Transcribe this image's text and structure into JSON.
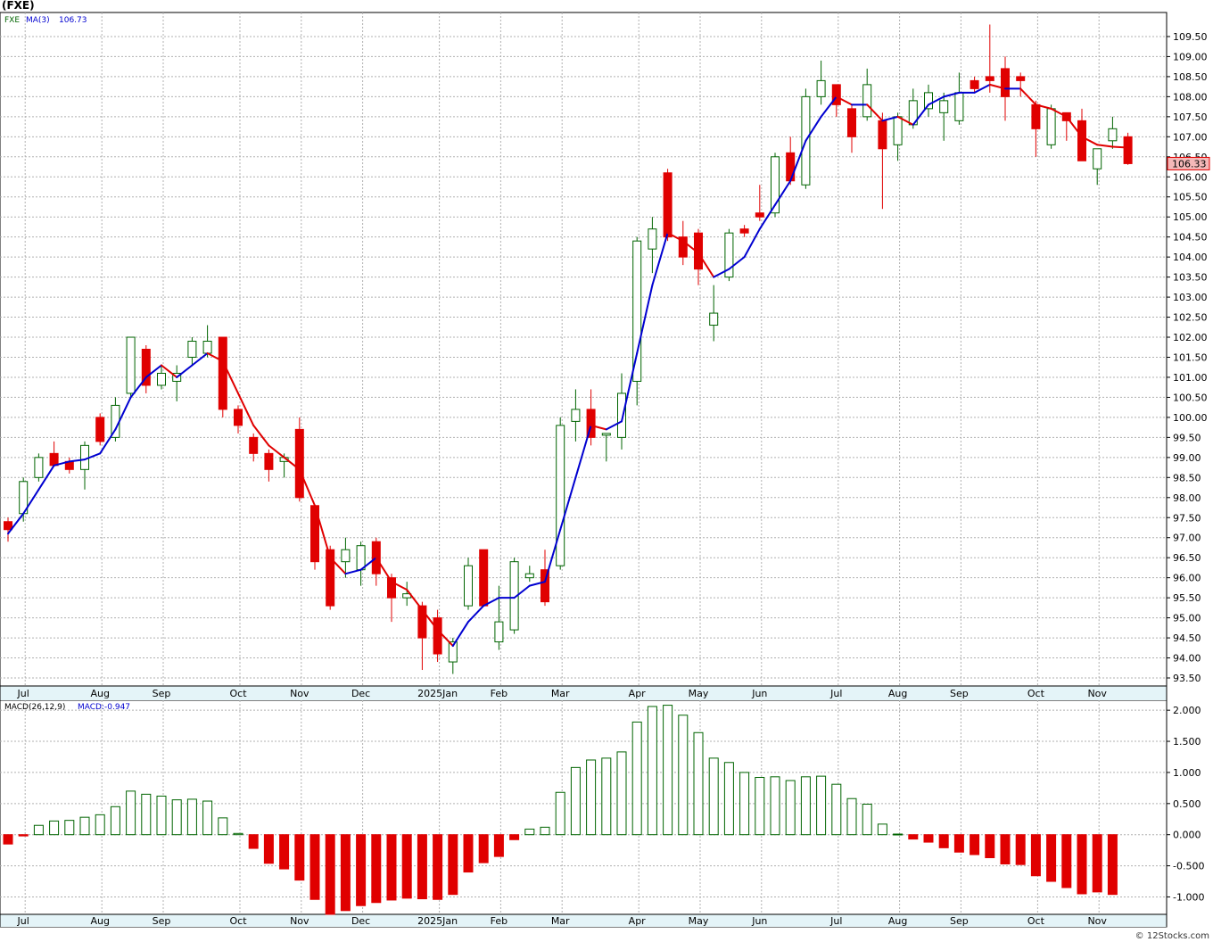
{
  "title": "(FXE)",
  "footer": "© 12Stocks.com",
  "colors": {
    "up": "#006400",
    "down": "#e00000",
    "ma_up": "#0000d0",
    "ma_down": "#e00000",
    "grid": "#b0b0b0",
    "label_red_bg": "#f4b8b8"
  },
  "chart_data": [
    {
      "type": "candlestick",
      "legend": {
        "ticker": "FXE",
        "ma_label": "MA(3)",
        "ma_value": "106.73"
      },
      "last_price_label": "106.33",
      "ylim": [
        93.3,
        110.1
      ],
      "y_ticks": [
        "93.50",
        "94.00",
        "94.50",
        "95.00",
        "95.50",
        "96.00",
        "96.50",
        "97.00",
        "97.50",
        "98.00",
        "98.50",
        "99.00",
        "99.50",
        "100.00",
        "100.50",
        "101.00",
        "101.50",
        "102.00",
        "102.50",
        "103.00",
        "103.50",
        "104.00",
        "104.50",
        "105.00",
        "105.50",
        "106.00",
        "106.50",
        "107.00",
        "107.50",
        "108.00",
        "108.50",
        "109.00",
        "109.50"
      ],
      "x_labels": [
        {
          "label": "Jul",
          "index": 1
        },
        {
          "label": "Aug",
          "index": 6
        },
        {
          "label": "Sep",
          "index": 10
        },
        {
          "label": "Oct",
          "index": 15
        },
        {
          "label": "Nov",
          "index": 19
        },
        {
          "label": "Dec",
          "index": 23
        },
        {
          "label": "2025Jan",
          "index": 28
        },
        {
          "label": "Feb",
          "index": 32
        },
        {
          "label": "Mar",
          "index": 36
        },
        {
          "label": "Apr",
          "index": 41
        },
        {
          "label": "May",
          "index": 45
        },
        {
          "label": "Jun",
          "index": 49
        },
        {
          "label": "Jul",
          "index": 54
        },
        {
          "label": "Aug",
          "index": 58
        },
        {
          "label": "Sep",
          "index": 62
        },
        {
          "label": "Oct",
          "index": 67
        },
        {
          "label": "Nov",
          "index": 71
        }
      ],
      "candles": [
        {
          "o": 97.4,
          "h": 97.5,
          "l": 96.9,
          "c": 97.2,
          "ma": 97.1
        },
        {
          "o": 97.6,
          "h": 98.5,
          "l": 97.4,
          "c": 98.4,
          "ma": 97.6
        },
        {
          "o": 98.5,
          "h": 99.1,
          "l": 98.4,
          "c": 99.0,
          "ma": 98.2
        },
        {
          "o": 99.1,
          "h": 99.4,
          "l": 98.8,
          "c": 98.8,
          "ma": 98.8
        },
        {
          "o": 98.9,
          "h": 99.0,
          "l": 98.6,
          "c": 98.7,
          "ma": 98.9
        },
        {
          "o": 98.7,
          "h": 99.4,
          "l": 98.2,
          "c": 99.3,
          "ma": 98.95
        },
        {
          "o": 100.0,
          "h": 100.1,
          "l": 99.3,
          "c": 99.4,
          "ma": 99.1
        },
        {
          "o": 99.5,
          "h": 100.5,
          "l": 99.4,
          "c": 100.3,
          "ma": 99.7
        },
        {
          "o": 100.6,
          "h": 102.0,
          "l": 100.5,
          "c": 102.0,
          "ma": 100.5
        },
        {
          "o": 101.7,
          "h": 101.8,
          "l": 100.6,
          "c": 100.8,
          "ma": 101.0
        },
        {
          "o": 100.8,
          "h": 101.3,
          "l": 100.7,
          "c": 101.1,
          "ma": 101.3
        },
        {
          "o": 100.9,
          "h": 101.3,
          "l": 100.4,
          "c": 101.1,
          "ma": 101.0
        },
        {
          "o": 101.5,
          "h": 102.0,
          "l": 101.3,
          "c": 101.9,
          "ma": 101.3
        },
        {
          "o": 101.6,
          "h": 102.3,
          "l": 101.5,
          "c": 101.9,
          "ma": 101.6
        },
        {
          "o": 102.0,
          "h": 102.0,
          "l": 100.0,
          "c": 100.2,
          "ma": 101.4
        },
        {
          "o": 100.2,
          "h": 100.3,
          "l": 99.6,
          "c": 99.8,
          "ma": 100.6
        },
        {
          "o": 99.5,
          "h": 99.6,
          "l": 98.9,
          "c": 99.1,
          "ma": 99.8
        },
        {
          "o": 99.1,
          "h": 99.2,
          "l": 98.4,
          "c": 98.7,
          "ma": 99.3
        },
        {
          "o": 98.9,
          "h": 99.1,
          "l": 98.5,
          "c": 99.0,
          "ma": 99.0
        },
        {
          "o": 99.7,
          "h": 100.0,
          "l": 97.9,
          "c": 98.0,
          "ma": 98.7
        },
        {
          "o": 97.8,
          "h": 97.8,
          "l": 96.2,
          "c": 96.4,
          "ma": 97.8
        },
        {
          "o": 96.7,
          "h": 96.8,
          "l": 95.2,
          "c": 95.3,
          "ma": 96.5
        },
        {
          "o": 96.4,
          "h": 97.0,
          "l": 96.0,
          "c": 96.7,
          "ma": 96.1
        },
        {
          "o": 96.2,
          "h": 96.9,
          "l": 95.8,
          "c": 96.8,
          "ma": 96.2
        },
        {
          "o": 96.9,
          "h": 97.0,
          "l": 95.8,
          "c": 96.1,
          "ma": 96.5
        },
        {
          "o": 96.0,
          "h": 96.1,
          "l": 94.9,
          "c": 95.5,
          "ma": 95.9
        },
        {
          "o": 95.5,
          "h": 95.9,
          "l": 95.3,
          "c": 95.6,
          "ma": 95.7
        },
        {
          "o": 95.3,
          "h": 95.4,
          "l": 93.7,
          "c": 94.5,
          "ma": 95.2
        },
        {
          "o": 95.0,
          "h": 95.2,
          "l": 93.9,
          "c": 94.1,
          "ma": 94.7
        },
        {
          "o": 93.9,
          "h": 94.5,
          "l": 93.6,
          "c": 94.4,
          "ma": 94.3
        },
        {
          "o": 95.3,
          "h": 96.5,
          "l": 95.2,
          "c": 96.3,
          "ma": 94.9
        },
        {
          "o": 96.7,
          "h": 96.7,
          "l": 95.3,
          "c": 95.3,
          "ma": 95.3
        },
        {
          "o": 94.4,
          "h": 95.8,
          "l": 94.2,
          "c": 94.9,
          "ma": 95.5
        },
        {
          "o": 94.7,
          "h": 96.5,
          "l": 94.6,
          "c": 96.4,
          "ma": 95.5
        },
        {
          "o": 96.0,
          "h": 96.3,
          "l": 95.9,
          "c": 96.1,
          "ma": 95.8
        },
        {
          "o": 96.2,
          "h": 96.7,
          "l": 95.3,
          "c": 95.4,
          "ma": 95.9
        },
        {
          "o": 96.3,
          "h": 100.0,
          "l": 96.2,
          "c": 99.8,
          "ma": 97.2
        },
        {
          "o": 99.9,
          "h": 100.7,
          "l": 99.4,
          "c": 100.2,
          "ma": 98.5
        },
        {
          "o": 100.2,
          "h": 100.7,
          "l": 99.3,
          "c": 99.5,
          "ma": 99.8
        },
        {
          "o": 99.6,
          "h": 99.6,
          "l": 98.9,
          "c": 99.6,
          "ma": 99.7
        },
        {
          "o": 99.5,
          "h": 101.1,
          "l": 99.2,
          "c": 100.6,
          "ma": 99.9
        },
        {
          "o": 100.9,
          "h": 104.5,
          "l": 100.3,
          "c": 104.4,
          "ma": 101.6
        },
        {
          "o": 104.2,
          "h": 105.0,
          "l": 103.6,
          "c": 104.7,
          "ma": 103.3
        },
        {
          "o": 106.1,
          "h": 106.2,
          "l": 104.4,
          "c": 104.5,
          "ma": 104.6
        },
        {
          "o": 104.5,
          "h": 104.9,
          "l": 103.8,
          "c": 104.0,
          "ma": 104.4
        },
        {
          "o": 104.6,
          "h": 104.7,
          "l": 103.3,
          "c": 103.7,
          "ma": 104.1
        },
        {
          "o": 102.3,
          "h": 103.3,
          "l": 101.9,
          "c": 102.6,
          "ma": 103.5
        },
        {
          "o": 103.5,
          "h": 104.7,
          "l": 103.4,
          "c": 104.6,
          "ma": 103.7
        },
        {
          "o": 104.7,
          "h": 104.8,
          "l": 104.5,
          "c": 104.6,
          "ma": 104.0
        },
        {
          "o": 105.1,
          "h": 105.8,
          "l": 104.9,
          "c": 105.0,
          "ma": 104.7
        },
        {
          "o": 105.1,
          "h": 106.6,
          "l": 105.0,
          "c": 106.5,
          "ma": 105.3
        },
        {
          "o": 106.6,
          "h": 107.0,
          "l": 105.8,
          "c": 105.9,
          "ma": 105.9
        },
        {
          "o": 105.8,
          "h": 108.2,
          "l": 105.7,
          "c": 108.0,
          "ma": 106.9
        },
        {
          "o": 108.0,
          "h": 108.9,
          "l": 107.8,
          "c": 108.4,
          "ma": 107.5
        },
        {
          "o": 108.3,
          "h": 108.3,
          "l": 107.5,
          "c": 107.8,
          "ma": 108.0
        },
        {
          "o": 107.7,
          "h": 107.8,
          "l": 106.6,
          "c": 107.0,
          "ma": 107.8
        },
        {
          "o": 107.5,
          "h": 108.7,
          "l": 107.4,
          "c": 108.3,
          "ma": 107.8
        },
        {
          "o": 107.4,
          "h": 107.6,
          "l": 105.2,
          "c": 106.7,
          "ma": 107.4
        },
        {
          "o": 106.8,
          "h": 107.6,
          "l": 106.4,
          "c": 107.5,
          "ma": 107.5
        },
        {
          "o": 107.3,
          "h": 108.2,
          "l": 107.2,
          "c": 107.9,
          "ma": 107.3
        },
        {
          "o": 107.7,
          "h": 108.3,
          "l": 107.5,
          "c": 108.1,
          "ma": 107.8
        },
        {
          "o": 107.6,
          "h": 108.1,
          "l": 106.9,
          "c": 107.9,
          "ma": 108.0
        },
        {
          "o": 107.4,
          "h": 108.6,
          "l": 107.3,
          "c": 108.1,
          "ma": 108.1
        },
        {
          "o": 108.4,
          "h": 108.5,
          "l": 108.1,
          "c": 108.2,
          "ma": 108.1
        },
        {
          "o": 108.5,
          "h": 109.8,
          "l": 108.1,
          "c": 108.4,
          "ma": 108.3
        },
        {
          "o": 108.7,
          "h": 109.0,
          "l": 107.4,
          "c": 108.0,
          "ma": 108.2
        },
        {
          "o": 108.5,
          "h": 108.6,
          "l": 108.0,
          "c": 108.4,
          "ma": 108.2
        },
        {
          "o": 107.8,
          "h": 107.9,
          "l": 106.5,
          "c": 107.2,
          "ma": 107.8
        },
        {
          "o": 106.8,
          "h": 107.8,
          "l": 106.7,
          "c": 107.7,
          "ma": 107.7
        },
        {
          "o": 107.6,
          "h": 107.6,
          "l": 106.9,
          "c": 107.4,
          "ma": 107.5
        },
        {
          "o": 107.4,
          "h": 107.7,
          "l": 106.4,
          "c": 106.4,
          "ma": 107.0
        },
        {
          "o": 106.2,
          "h": 106.7,
          "l": 105.8,
          "c": 106.7,
          "ma": 106.8
        },
        {
          "o": 106.9,
          "h": 107.5,
          "l": 106.7,
          "c": 107.2,
          "ma": 106.75
        },
        {
          "o": 107.0,
          "h": 107.1,
          "l": 106.3,
          "c": 106.33,
          "ma": 106.73
        }
      ]
    },
    {
      "type": "bar",
      "legend": {
        "name": "MACD(26,12,9)",
        "value_label": "MACD:-0.947"
      },
      "ylim": [
        -1.28,
        2.16
      ],
      "y_ticks": [
        "-1.000",
        "-0.500",
        "0.000",
        "0.500",
        "1.000",
        "1.500",
        "2.000"
      ],
      "values": [
        -0.15,
        -0.02,
        0.15,
        0.22,
        0.23,
        0.28,
        0.32,
        0.45,
        0.7,
        0.65,
        0.62,
        0.56,
        0.57,
        0.54,
        0.27,
        0.02,
        -0.22,
        -0.46,
        -0.55,
        -0.73,
        -1.04,
        -1.28,
        -1.22,
        -1.14,
        -1.09,
        -1.05,
        -1.02,
        -1.03,
        -1.04,
        -0.96,
        -0.6,
        -0.45,
        -0.35,
        -0.08,
        0.09,
        0.12,
        0.68,
        1.08,
        1.2,
        1.23,
        1.33,
        1.81,
        2.06,
        2.08,
        1.92,
        1.64,
        1.23,
        1.16,
        1.0,
        0.92,
        0.93,
        0.87,
        0.93,
        0.94,
        0.81,
        0.58,
        0.49,
        0.17,
        0.01,
        -0.07,
        -0.12,
        -0.21,
        -0.28,
        -0.32,
        -0.37,
        -0.47,
        -0.48,
        -0.66,
        -0.75,
        -0.85,
        -0.95,
        -0.92,
        -0.96
      ]
    }
  ]
}
